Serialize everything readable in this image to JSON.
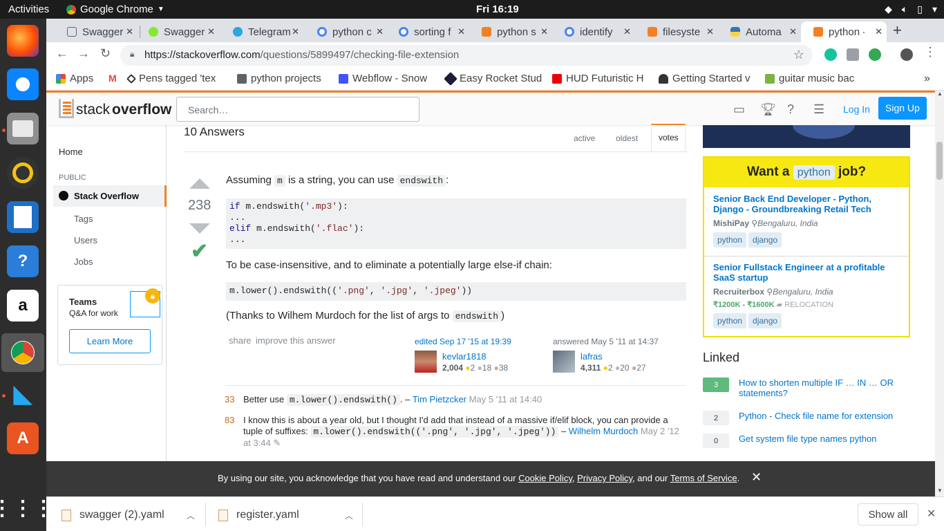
{
  "system": {
    "activities": "Activities",
    "app_name": "Google Chrome",
    "clock": "Fri 16:19"
  },
  "tabs": [
    {
      "label": "Swagger"
    },
    {
      "label": "Swagger"
    },
    {
      "label": "Telegram"
    },
    {
      "label": "python c"
    },
    {
      "label": "sorting f"
    },
    {
      "label": "python s"
    },
    {
      "label": "identify"
    },
    {
      "label": "filesyste"
    },
    {
      "label": "Automa"
    },
    {
      "label": "python -"
    }
  ],
  "address_bar": {
    "host": "https://stackoverflow.com",
    "path": "/questions/5899497/checking-file-extension"
  },
  "bookmarks": [
    {
      "label": "Apps"
    },
    {
      "label": ""
    },
    {
      "label": "Pens tagged 'tex"
    },
    {
      "label": "python projects"
    },
    {
      "label": "Webflow - Snow"
    },
    {
      "label": "Easy Rocket Stud"
    },
    {
      "label": "HUD Futuristic H"
    },
    {
      "label": "Getting Started v"
    },
    {
      "label": "guitar music bac"
    }
  ],
  "so": {
    "logo_a": "stack",
    "logo_b": "overflow",
    "search_placeholder": "Search…",
    "login": "Log In",
    "signup": "Sign Up"
  },
  "leftnav": {
    "home": "Home",
    "public": "PUBLIC",
    "stackoverflow": "Stack Overflow",
    "tags": "Tags",
    "users": "Users",
    "jobs": "Jobs",
    "teams_title": "Teams",
    "teams_sub": "Q&A for work",
    "learn_more": "Learn More"
  },
  "answers": {
    "heading": "10 Answers",
    "tabs": [
      "active",
      "oldest",
      "votes"
    ],
    "votes": "238",
    "p1_a": "Assuming ",
    "p1_code1": "m",
    "p1_b": " is a string, you can use ",
    "p1_code2": "endswith",
    "p1_c": ":",
    "code1": {
      "l1_kw": "if",
      "l1_a": " m.endswith(",
      "l1_s": "'.mp3'",
      "l1_b": "):",
      "l2": "...",
      "l3_kw": "elif",
      "l3_a": " m.endswith(",
      "l3_s": "'.flac'",
      "l3_b": "):",
      "l4": "..."
    },
    "p2": "To be case-insensitive, and to eliminate a potentially large else-if chain:",
    "code2": {
      "a": "m.lower().endswith((",
      "s1": "'.png'",
      "c1": ", ",
      "s2": "'.jpg'",
      "c2": ", ",
      "s3": "'.jpeg'",
      "b": "))"
    },
    "p3_a": "(Thanks to Wilhem Murdoch for the list of args to ",
    "p3_code": "endswith",
    "p3_b": ")",
    "share": "share",
    "improve": "improve this answer",
    "edited": "edited Sep 17 '15 at 19:39",
    "editor_name": "kevlar1818",
    "editor_rep": "2,004",
    "editor_gold": "2",
    "editor_silver": "18",
    "editor_bronze": "38",
    "answered": "answered May 5 '11 at 14:37",
    "author_name": "lafras",
    "author_rep": "4,311",
    "author_gold": "2",
    "author_silver": "20",
    "author_bronze": "27"
  },
  "comments": [
    {
      "score": "33",
      "a": "Better use ",
      "code": "m.lower().endswith()",
      "b": ". –",
      "user": "Tim Pietzcker",
      "date": "May 5 '11 at 14:40"
    },
    {
      "score": "83",
      "a": "I know this is about a year old, but I thought I'd add that instead of a massive if/elif block, you can provide a tuple of suffixes: ",
      "code": "m.lower().endswith(('.png', '.jpg', '.jpeg'))",
      "b": " –",
      "user": "Wilhelm Murdoch",
      "date": "May 2 '12 at 3:44"
    }
  ],
  "jobs": {
    "want_a": "Want a",
    "lang": "python",
    "job": "job?",
    "items": [
      {
        "title": "Senior Back End Developer - Python, Django - Groundbreaking Retail Tech",
        "company": "MishiPay",
        "location": "Bengaluru, India",
        "salary": "",
        "relocation": "",
        "tags": [
          "python",
          "django"
        ]
      },
      {
        "title": "Senior Fullstack Engineer at a profitable SaaS startup",
        "company": "Recruiterbox",
        "location": "Bengaluru, India",
        "salary": "₹1200K - ₹1600K",
        "relocation": "RELOCATION",
        "tags": [
          "python",
          "django"
        ]
      }
    ]
  },
  "linked": {
    "heading": "Linked",
    "items": [
      {
        "count": "3",
        "title": "How to shorten multiple IF … IN … OR statements?"
      },
      {
        "count": "2",
        "title": "Python - Check file name for extension"
      },
      {
        "count": "0",
        "title": "Get system file type names python"
      }
    ]
  },
  "cookie": {
    "a": "By using our site, you acknowledge that you have read and understand our ",
    "cookie_policy": "Cookie Policy",
    "sep": ", ",
    "privacy_policy": "Privacy Policy",
    "and": ", and our ",
    "terms": "Terms of Service",
    "end": "."
  },
  "downloads": {
    "files": [
      "swagger (2).yaml",
      "register.yaml"
    ],
    "show_all": "Show all"
  }
}
